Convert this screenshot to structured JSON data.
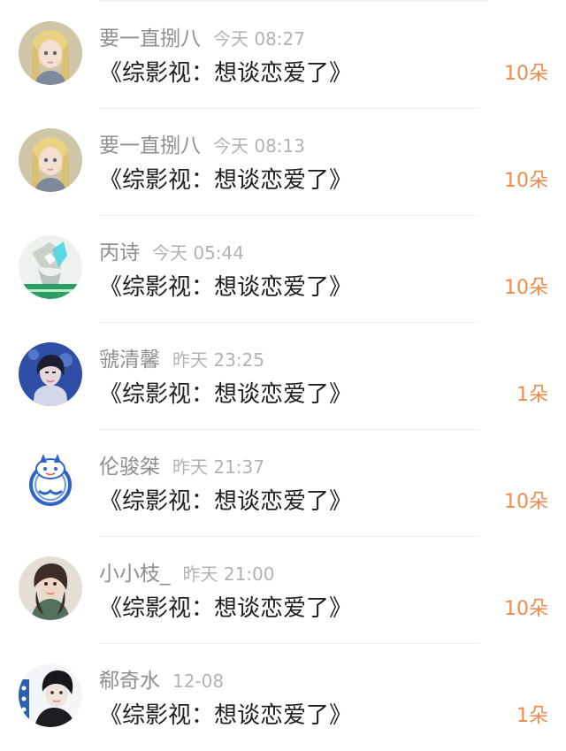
{
  "entries": [
    {
      "name": "要一直捌八",
      "time": "今天 08:27",
      "title": "《综影视：想谈恋爱了》",
      "count": "10朵",
      "avatar": "anime-girl-blonde-avatar"
    },
    {
      "name": "要一直捌八",
      "time": "今天 08:13",
      "title": "《综影视：想谈恋爱了》",
      "count": "10朵",
      "avatar": "anime-girl-blonde-avatar"
    },
    {
      "name": "丙诗",
      "time": "今天 05:44",
      "title": "《综影视：想谈恋爱了》",
      "count": "10朵",
      "avatar": "illustrated-teal-avatar"
    },
    {
      "name": "虢清馨",
      "time": "昨天 23:25",
      "title": "《综影视：想谈恋爱了》",
      "count": "1朵",
      "avatar": "blue-stage-portrait-avatar"
    },
    {
      "name": "伦骏桀",
      "time": "昨天 21:37",
      "title": "《综影视：想谈恋爱了》",
      "count": "10朵",
      "avatar": "blue-white-porcelain-tiger-avatar"
    },
    {
      "name": "小小枝_",
      "time": "昨天 21:00",
      "title": "《综影视：想谈恋爱了》",
      "count": "10朵",
      "avatar": "portrait-woman-avatar"
    },
    {
      "name": "郗奇水",
      "time": "12-08",
      "title": "《综影视：想谈恋爱了》",
      "count": "1朵",
      "avatar": "dark-hair-portrait-avatar"
    }
  ],
  "colors": {
    "name": "#8f8f8f",
    "time": "#b3b3b3",
    "title": "#1f1f1f",
    "count": "#ee8a4a",
    "divider": "#efefef"
  }
}
